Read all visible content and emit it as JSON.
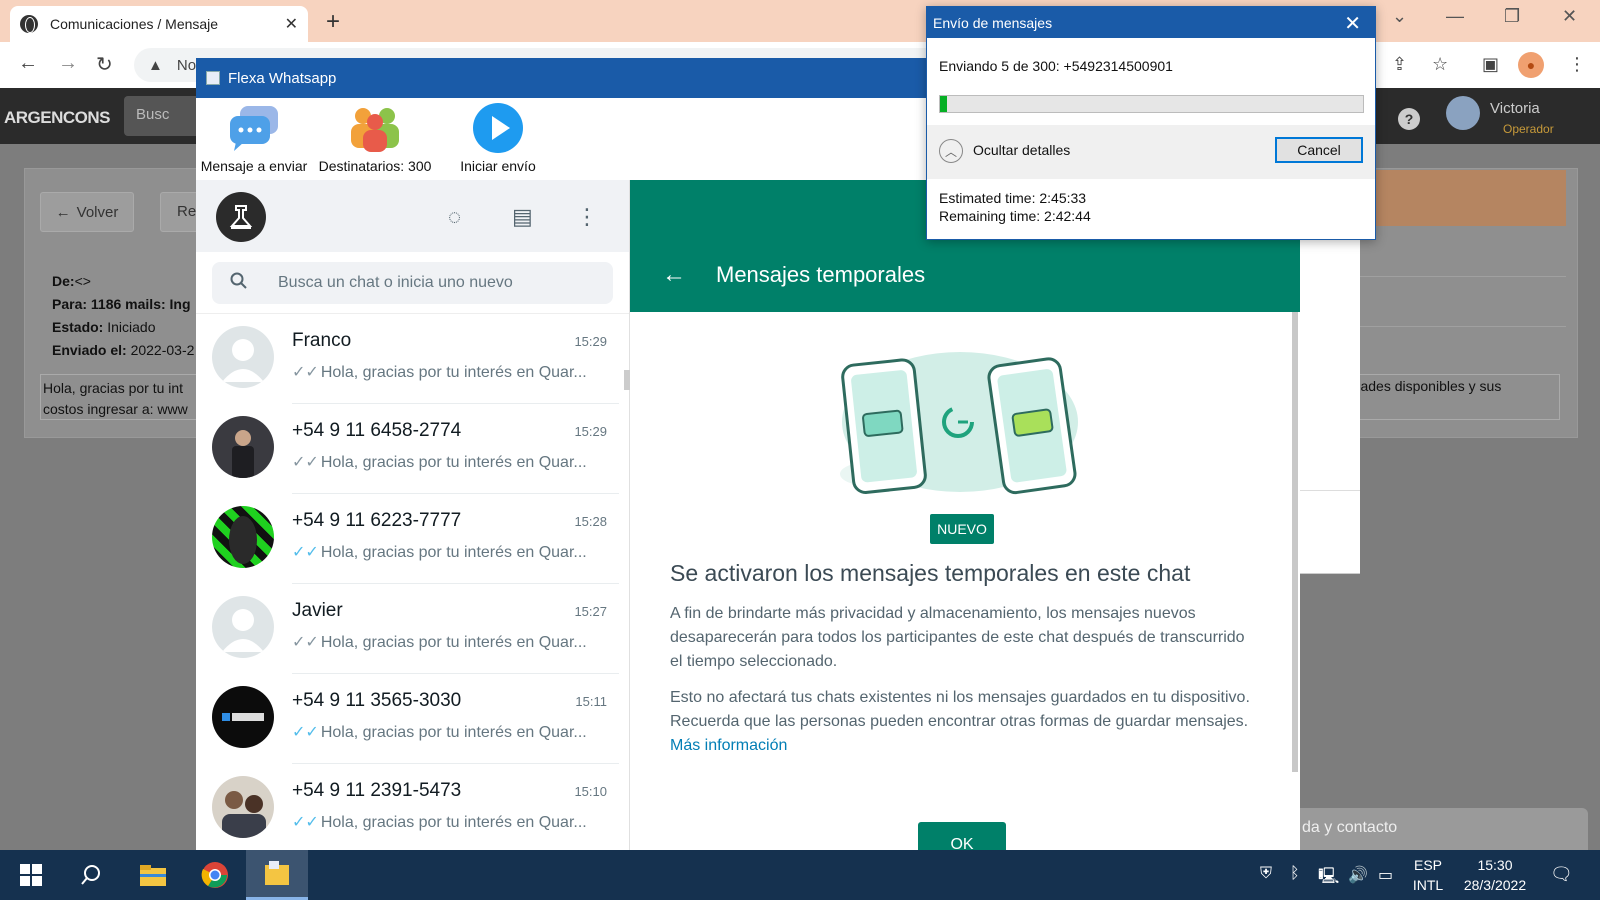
{
  "browser": {
    "tab_title": "Comunicaciones / Mensaje",
    "tab_close": "✕",
    "new_tab": "+",
    "address_partial": "No"
  },
  "site": {
    "logo": "ARGENCONS",
    "search_placeholder": "Busc",
    "help": "?",
    "user_name": "Victoria",
    "user_role": "Operador",
    "back_button": "Volver",
    "second_button": "Re",
    "meta": {
      "de_label": "De:",
      "de_value": "<>",
      "para_label": "Para:",
      "para_value": "1186 mails: Ing",
      "estado_label": "Estado:",
      "estado_value": "Iniciado",
      "enviado_label": "Enviado el:",
      "enviado_value": "2022-03-2"
    },
    "message_left": "Hola, gracias por tu int costos ingresar a: www",
    "message_right": "unidades disponibles y sus",
    "help_contact": "da y contacto"
  },
  "flexa": {
    "window_title": "Flexa Whatsapp",
    "toolbar": {
      "message_label": "Mensaje a enviar",
      "recipients_label": "Destinatarios: 300",
      "start_label": "Iniciar envío"
    },
    "search_placeholder": "Busca un chat o inicia uno nuevo",
    "chats": [
      {
        "name": "Franco",
        "time": "15:29",
        "preview": "Hola, gracias por tu interés en Quar..."
      },
      {
        "name": "+54 9 11 6458-2774",
        "time": "15:29",
        "preview": "Hola, gracias por tu interés en Quar..."
      },
      {
        "name": "+54 9 11 6223-7777",
        "time": "15:28",
        "preview": "Hola, gracias por tu interés en Quar..."
      },
      {
        "name": "Javier",
        "time": "15:27",
        "preview": "Hola, gracias por tu interés en Quar..."
      },
      {
        "name": "+54 9 11 3565-3030",
        "time": "15:11",
        "preview": "Hola, gracias por tu interés en Quar..."
      },
      {
        "name": "+54 9 11 2391-5473",
        "time": "15:10",
        "preview": "Hola, gracias por tu interés en Quar..."
      }
    ],
    "temp_panel": {
      "title": "Mensajes temporales",
      "badge": "NUEVO",
      "heading": "Se activaron los mensajes temporales en este chat",
      "para1": "A fin de brindarte más privacidad y almacenamiento, los mensajes nuevos desaparecerán para todos los participantes de este chat después de transcurrido el tiempo seleccionado.",
      "para2": "Esto no afectará tus chats existentes ni los mensajes guardados en tu dispositivo. Recuerda que las personas pueden encontrar otras formas de guardar mensajes.",
      "link": "Más información",
      "ok_button": "OK"
    }
  },
  "dialog": {
    "title": "Envío de mensajes",
    "status": "Enviando 5 de 300: +5492314500901",
    "progress_fraction": 0.0167,
    "details_label": "Ocultar detalles",
    "cancel_button": "Cancel",
    "estimated": "Estimated time: 2:45:33",
    "remaining": "Remaining time: 2:42:44"
  },
  "taskbar": {
    "lang_top": "ESP",
    "lang_bottom": "INTL",
    "time": "15:30",
    "date": "28/3/2022"
  },
  "colors": {
    "whatsapp_green": "#008069",
    "titlebar_blue": "#1a5ba8",
    "progress_green": "#06b025",
    "taskbar": "#15314f"
  }
}
